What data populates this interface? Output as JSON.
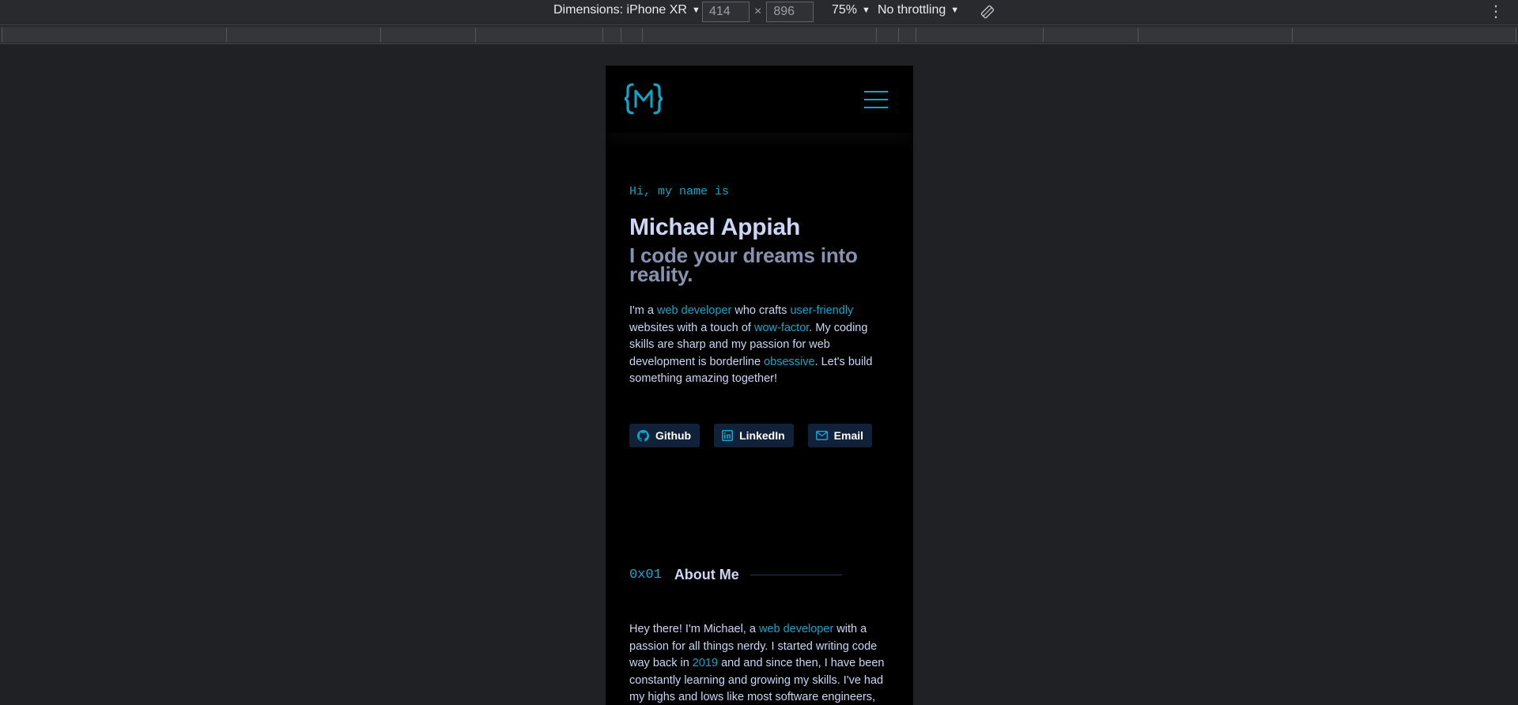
{
  "devtools": {
    "device_label": "Dimensions: iPhone XR",
    "width_value": "414",
    "height_value": "896",
    "times": "×",
    "zoom": "75%",
    "throttling": "No throttling",
    "more_icon": "⋮"
  },
  "site": {
    "logo_text": "{M}",
    "greeting": "Hi, my name is",
    "name": "Michael Appiah",
    "tagline": "I code your dreams into reality.",
    "bio": {
      "p1": "I'm a ",
      "a1": "web developer",
      "p2": " who crafts ",
      "a2": "user-friendly",
      "p3": " websites with a touch of ",
      "a3": "wow-factor",
      "p4": ". My coding skills are sharp and my passion for web development is borderline ",
      "a4": "obsessive",
      "p5": ". Let's build something amazing together!"
    },
    "social": [
      {
        "label": "Github",
        "icon": "github-icon"
      },
      {
        "label": "LinkedIn",
        "icon": "linkedin-icon"
      },
      {
        "label": "Email",
        "icon": "mail-icon"
      }
    ],
    "about": {
      "number": "0x01",
      "title": "About Me",
      "p1": "Hey there! I'm Michael, a ",
      "a1": "web developer",
      "p2": " with a passion for all things nerdy. I started writing code way back in ",
      "a2": "2019",
      "p3": " and and since then, I have been constantly learning and growing my skills. I've had my highs and lows like most software engineers,"
    },
    "accent_color": "#10a6c8",
    "background_color": "#000000"
  }
}
